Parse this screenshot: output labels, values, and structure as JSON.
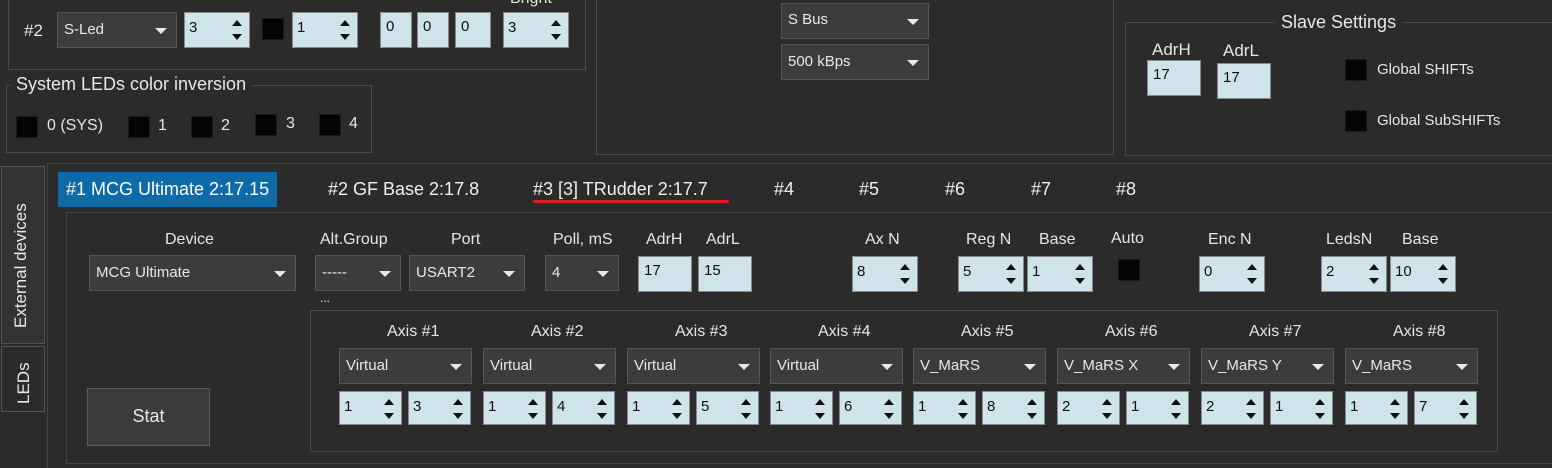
{
  "top_row": {
    "index_label": "#2",
    "type": "S-Led",
    "spin1": "3",
    "spin2": "1",
    "f1": "0",
    "f2": "0",
    "f3": "0",
    "bright_label": "Bright",
    "bright": "3"
  },
  "sys_leds": {
    "title": "System LEDs color inversion",
    "items": [
      "0 (SYS)",
      "1",
      "2",
      "3",
      "4"
    ]
  },
  "bus": {
    "bus_type": "S Bus",
    "speed": "500 kBps"
  },
  "slave": {
    "title": "Slave Settings",
    "adrh_label": "AdrH",
    "adrl_label": "AdrL",
    "adrh": "17",
    "adrl": "17",
    "global_shifts": "Global SHIFTs",
    "global_subshifts": "Global SubSHIFTs"
  },
  "side_tabs": {
    "external": "External devices",
    "leds": "LEDs"
  },
  "tabs": [
    "#1 MCG Ultimate 2:17.15",
    "#2 GF Base 2:17.8",
    "#3 [3] TRudder 2:17.7",
    "#4",
    "#5",
    "#6",
    "#7",
    "#8"
  ],
  "device": {
    "labels": {
      "device": "Device",
      "alt_group": "Alt.Group",
      "port": "Port",
      "poll": "Poll, mS",
      "adrh": "AdrH",
      "adrl": "AdrL",
      "axn": "Ax N",
      "regn": "Reg N",
      "base": "Base",
      "auto": "Auto",
      "encn": "Enc N",
      "ledsn": "LedsN",
      "base2": "Base"
    },
    "device": "MCG Ultimate",
    "alt_group": "-----",
    "port": "USART2",
    "poll": "4",
    "adrh": "17",
    "adrl": "15",
    "axn": "8",
    "regn": "5",
    "base": "1",
    "encn": "0",
    "ledsn": "2",
    "base2": "10",
    "ellipsis": "...",
    "stat_button": "Stat"
  },
  "axes": [
    {
      "label": "Axis #1",
      "type": "Virtual",
      "a": "1",
      "b": "3"
    },
    {
      "label": "Axis #2",
      "type": "Virtual",
      "a": "1",
      "b": "4"
    },
    {
      "label": "Axis #3",
      "type": "Virtual",
      "a": "1",
      "b": "5"
    },
    {
      "label": "Axis #4",
      "type": "Virtual",
      "a": "1",
      "b": "6"
    },
    {
      "label": "Axis #5",
      "type": "V_MaRS",
      "a": "1",
      "b": "8"
    },
    {
      "label": "Axis #6",
      "type": "V_MaRS X",
      "a": "2",
      "b": "1"
    },
    {
      "label": "Axis #7",
      "type": "V_MaRS Y",
      "a": "2",
      "b": "1"
    },
    {
      "label": "Axis #8",
      "type": "V_MaRS",
      "a": "1",
      "b": "7"
    }
  ],
  "colors": {
    "accent_tab": "#0f6aa8",
    "underline": "#d81e1e",
    "field_bg": "#cfe3ea"
  }
}
